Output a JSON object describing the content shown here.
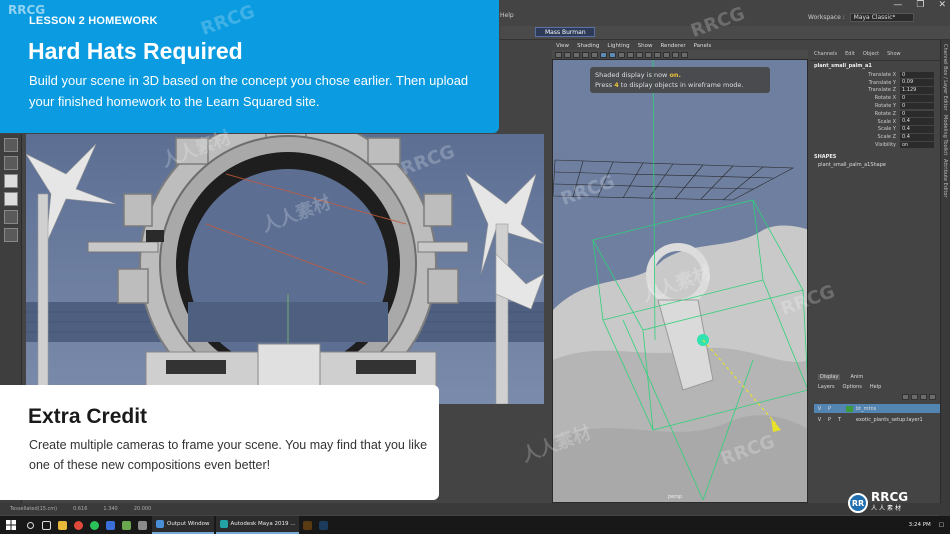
{
  "watermark": {
    "brand": "RRCG",
    "cjk": "人人素材"
  },
  "maya": {
    "menu_fragment": "Help",
    "workspace_label": "Workspace :",
    "workspace_value": "Maya Classic*",
    "character_select": "Mass Burman",
    "window_controls": [
      "—",
      "❐",
      "✕"
    ]
  },
  "viewport_right": {
    "menu": [
      "View",
      "Shading",
      "Lighting",
      "Show",
      "Renderer",
      "Panels"
    ],
    "hud_line1_prefix": "Shaded display is now ",
    "hud_line1_highlight": "on.",
    "hud_line2_prefix": "Press ",
    "hud_line2_key": "4",
    "hud_line2_suffix": " to display objects in wireframe mode.",
    "camera_label": "persp"
  },
  "channel_box": {
    "menu": [
      "Channels",
      "Edit",
      "Object",
      "Show"
    ],
    "object_name": "plant_small_palm_a1",
    "attributes": [
      {
        "name": "Translate X",
        "value": "0"
      },
      {
        "name": "Translate Y",
        "value": "0.09"
      },
      {
        "name": "Translate Z",
        "value": "1.129"
      },
      {
        "name": "Rotate X",
        "value": "0"
      },
      {
        "name": "Rotate Y",
        "value": "0"
      },
      {
        "name": "Rotate Z",
        "value": "0"
      },
      {
        "name": "Scale X",
        "value": "0.4"
      },
      {
        "name": "Scale Y",
        "value": "0.4"
      },
      {
        "name": "Scale Z",
        "value": "0.4"
      },
      {
        "name": "Visibility",
        "value": "on"
      }
    ],
    "shapes_header": "SHAPES",
    "shape_name": "plant_small_palm_a1Shape"
  },
  "side_tabs": [
    "Channel Box / Layer Editor",
    "Modeling Toolkit",
    "Attribute Editor"
  ],
  "layer_editor": {
    "tabs": [
      "Display",
      "Anim"
    ],
    "menu": [
      "Layers",
      "Options",
      "Help"
    ],
    "rows": [
      {
        "v": "V",
        "p": "P",
        "t": "",
        "name": "bt_mtns",
        "color": "#3c9a3c",
        "selected": true
      },
      {
        "v": "V",
        "p": "P",
        "t": "T",
        "name": "exotic_plants_setup:layer1",
        "color": "",
        "selected": false
      }
    ]
  },
  "status_bar": [
    "Tessellated(15.cm)",
    "0.616",
    "1.340",
    "20.000"
  ],
  "taskbar": {
    "tasks": [
      {
        "label": "Output Window",
        "color": "#4a90d9"
      },
      {
        "label": "Autodesk Maya 2019 ...",
        "color": "#1fa3a3"
      }
    ],
    "time": "3:24 PM"
  },
  "homework_card": {
    "lesson": "LESSON 2 HOMEWORK",
    "title": "Hard Hats Required",
    "body": "Build your scene in 3D based on the concept you chose earlier. Then upload your finished homework to the Learn Squared site."
  },
  "extra_credit_card": {
    "title": "Extra Credit",
    "body": "Create multiple cameras to frame your scene. You may find that you like one of these new compositions even better!"
  },
  "colors": {
    "card_blue": "#0a9be0",
    "maya_bg": "#444444",
    "viewport_sky": "#6e7fa0",
    "hud_highlight": "#e8c23a",
    "layer_selected": "#5385b2"
  }
}
